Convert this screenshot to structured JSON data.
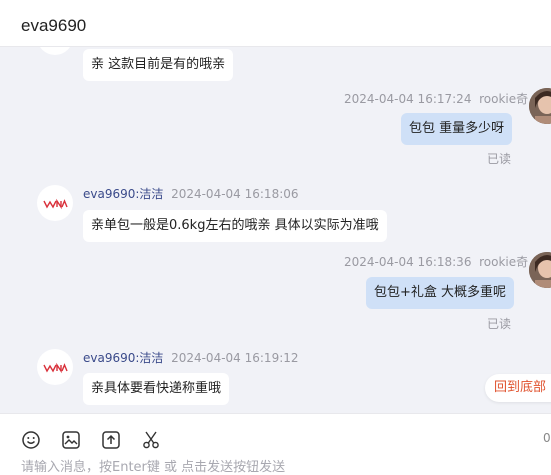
{
  "header": {
    "title": "eva9690"
  },
  "messages": [
    {
      "side": "left",
      "text": "亲 这款目前是有的哦亲"
    },
    {
      "side": "right",
      "time": "2024-04-04 16:17:24",
      "sender": "rookie奇",
      "text": "包包 重量多少呀",
      "status": "已读"
    },
    {
      "side": "left",
      "sender": "eva9690:洁洁",
      "time": "2024-04-04 16:18:06",
      "text": "亲单包一般是0.6kg左右的哦亲  具体以实际为准哦"
    },
    {
      "side": "right",
      "time": "2024-04-04 16:18:36",
      "sender": "rookie奇",
      "text": "包包+礼盒 大概多重呢",
      "status": "已读"
    },
    {
      "side": "left",
      "sender": "eva9690:洁洁",
      "time": "2024-04-04 16:19:12",
      "text": "亲具体要看快递称重哦"
    }
  ],
  "back_to_bottom": "回到底部",
  "toolbar": {
    "icons": [
      "emoji-icon",
      "image-icon",
      "upload-icon",
      "scissors-icon"
    ],
    "counter": "0",
    "placeholder": "请输入消息，按Enter键 或 点击发送按钮发送"
  },
  "colors": {
    "brand_logo": "#d9303a",
    "bubble_right": "#cfe0f7",
    "back_to_bottom": "#e0532f"
  }
}
